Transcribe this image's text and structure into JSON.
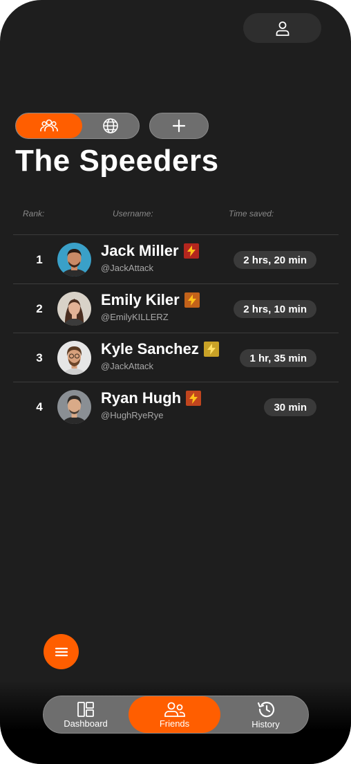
{
  "header": {
    "profile_icon": "user-icon"
  },
  "toggle": {
    "friends_icon": "group-icon",
    "global_icon": "globe-icon",
    "add_icon": "plus-icon"
  },
  "page": {
    "title": "The Speeders"
  },
  "columns": {
    "rank": "Rank:",
    "username": "Username:",
    "time": "Time saved:"
  },
  "leaderboard": [
    {
      "rank": "1",
      "name": "Jack Miller",
      "handle": "@JackAttack",
      "time": "2 hrs, 20 min",
      "badge_color": "#b3261e",
      "avatar_bg": "#3aa0c8",
      "skin": "#c98a66",
      "hair": "#2a1a12"
    },
    {
      "rank": "2",
      "name": "Emily Kiler",
      "handle": "@EmilyKILLERZ",
      "time": "2 hrs, 10 min",
      "badge_color": "#c2621a",
      "avatar_bg": "#d8d2c8",
      "skin": "#e2b296",
      "hair": "#4a2e20"
    },
    {
      "rank": "3",
      "name": "Kyle Sanchez",
      "handle": "@JackAttack",
      "time": "1 hr, 35 min",
      "badge_color": "#c9a227",
      "avatar_bg": "#e6e6e6",
      "skin": "#d7a07c",
      "hair": "#5a3a22"
    },
    {
      "rank": "4",
      "name": "Ryan Hugh",
      "handle": "@HughRyeRye",
      "time": "30 min",
      "badge_color": "#c0451e",
      "avatar_bg": "#8a8f94",
      "skin": "#d9aa88",
      "hair": "#2e2a26"
    }
  ],
  "fab": {
    "icon": "menu-icon"
  },
  "nav": {
    "items": [
      {
        "label": "Dashboard",
        "icon": "dashboard-icon"
      },
      {
        "label": "Friends",
        "icon": "friends-icon"
      },
      {
        "label": "History",
        "icon": "history-icon"
      }
    ],
    "active_index": 1
  },
  "colors": {
    "accent": "#ff5e00",
    "background": "#1e1e1e",
    "pill": "#6e6e6e"
  }
}
